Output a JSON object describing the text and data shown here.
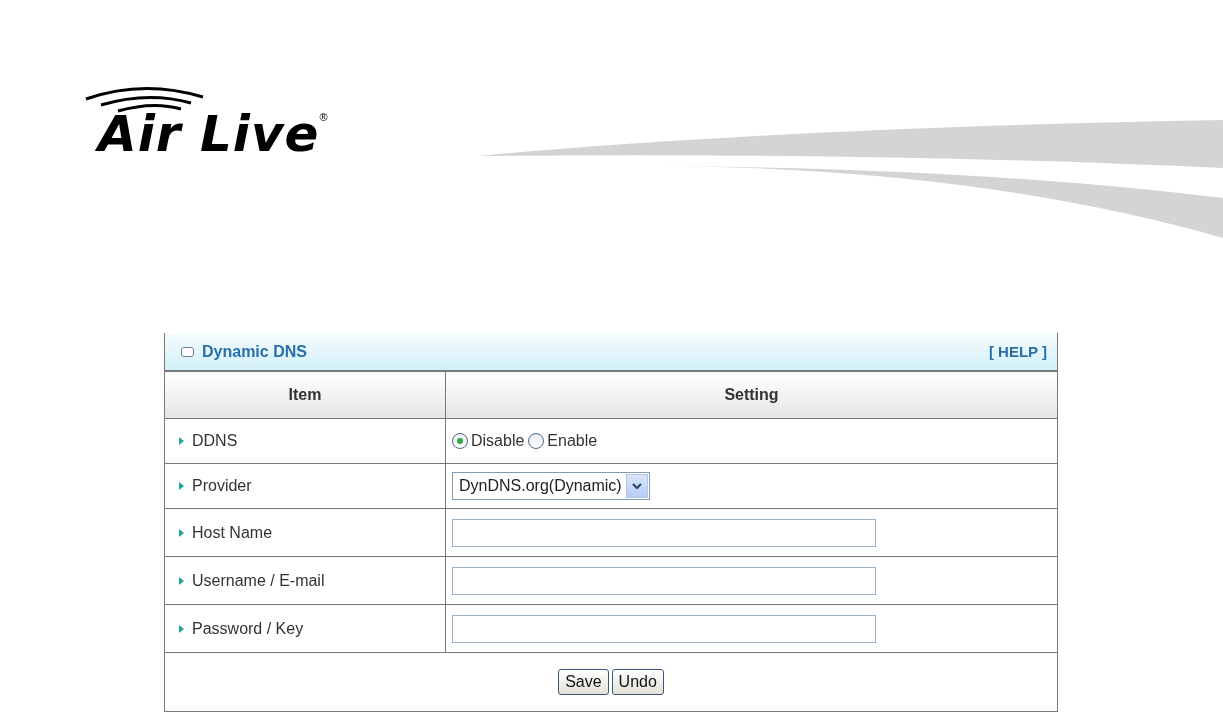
{
  "logo": {
    "text": "Air Live",
    "mark": "®"
  },
  "panel": {
    "title": "Dynamic DNS",
    "help": "[ HELP ]",
    "columns": [
      "Item",
      "Setting"
    ],
    "rows": [
      {
        "label": "DDNS",
        "kind": "radio",
        "options": [
          {
            "label": "Disable",
            "selected": true
          },
          {
            "label": "Enable",
            "selected": false
          }
        ]
      },
      {
        "label": "Provider",
        "kind": "select",
        "value": "DynDNS.org(Dynamic)"
      },
      {
        "label": "Host Name",
        "kind": "text"
      },
      {
        "label": "Username / E-mail",
        "kind": "text"
      },
      {
        "label": "Password / Key",
        "kind": "text"
      }
    ],
    "buttons": [
      "Save",
      "Undo"
    ]
  }
}
